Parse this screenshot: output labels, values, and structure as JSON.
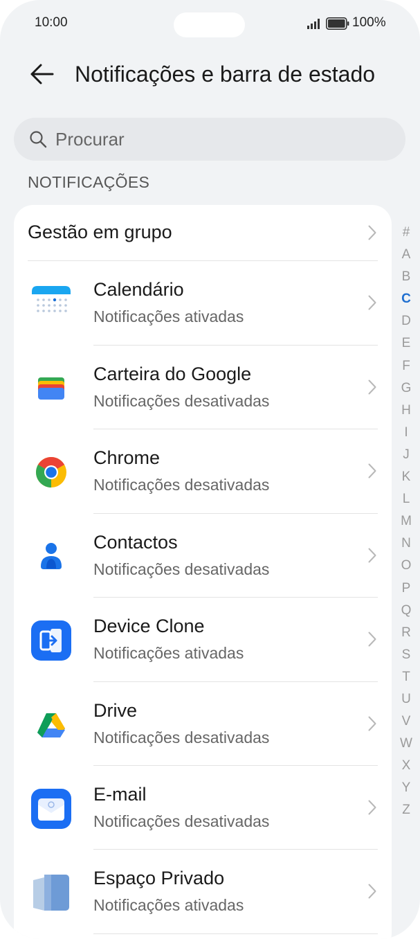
{
  "status_bar": {
    "time": "10:00",
    "battery": "100%"
  },
  "header": {
    "title": "Notificações e barra de estado"
  },
  "search": {
    "placeholder": "Procurar"
  },
  "section_label": "NOTIFICAÇÕES",
  "group_management": {
    "label": "Gestão em grupo"
  },
  "apps": [
    {
      "name": "Calendário",
      "status": "Notificações ativadas",
      "icon": "calendar-icon"
    },
    {
      "name": "Carteira do Google",
      "status": "Notificações desativadas",
      "icon": "google-wallet-icon"
    },
    {
      "name": "Chrome",
      "status": "Notificações desativadas",
      "icon": "chrome-icon"
    },
    {
      "name": "Contactos",
      "status": "Notificações desativadas",
      "icon": "contacts-icon"
    },
    {
      "name": "Device Clone",
      "status": "Notificações ativadas",
      "icon": "device-clone-icon"
    },
    {
      "name": "Drive",
      "status": "Notificações desativadas",
      "icon": "google-drive-icon"
    },
    {
      "name": "E-mail",
      "status": "Notificações desativadas",
      "icon": "email-icon"
    },
    {
      "name": "Espaço Privado",
      "status": "Notificações ativadas",
      "icon": "private-space-icon"
    }
  ],
  "alphabet_index": [
    "#",
    "A",
    "B",
    "C",
    "D",
    "E",
    "F",
    "G",
    "H",
    "I",
    "J",
    "K",
    "L",
    "M",
    "N",
    "O",
    "P",
    "Q",
    "R",
    "S",
    "T",
    "U",
    "V",
    "W",
    "X",
    "Y",
    "Z"
  ],
  "alphabet_active": "C",
  "colors": {
    "accent": "#1f6fd0",
    "background": "#f1f3f5",
    "card": "#ffffff"
  }
}
